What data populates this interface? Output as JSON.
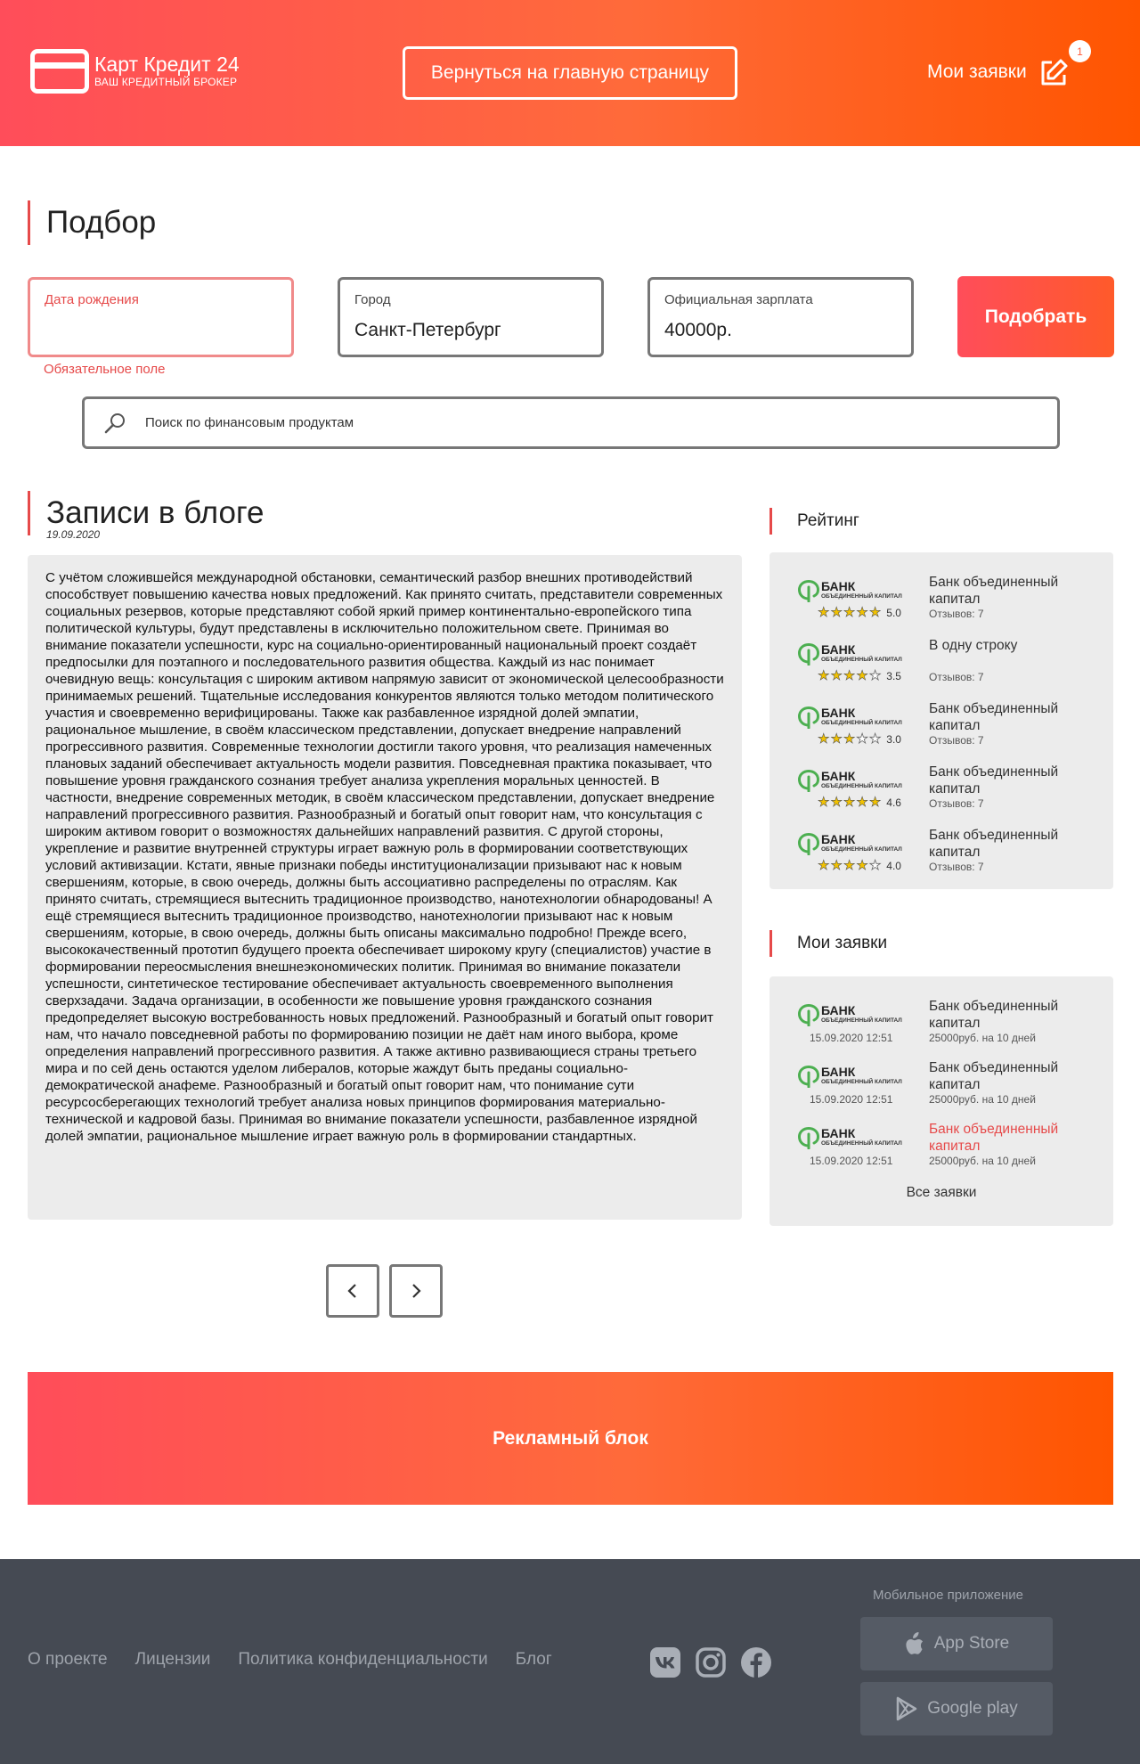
{
  "header": {
    "brand_name": "Карт Кредит 24",
    "brand_tagline": "ВАШ КРЕДИТНЫЙ БРОКЕР",
    "home_button": "Вернуться на главную страницу",
    "my_applications": "Мои заявки",
    "notification_count": "1"
  },
  "selection": {
    "title": "Подбор",
    "birthdate_label": "Дата рождения",
    "birthdate_value": "",
    "birthdate_error": "Обязательное поле",
    "city_label": "Город",
    "city_value": "Санкт-Петербург",
    "salary_label": "Официальная зарплата",
    "salary_value": "40000р.",
    "submit_label": "Подобрать"
  },
  "search": {
    "placeholder": "Поиск по финансовым продуктам"
  },
  "blog": {
    "title": "Записи в блоге",
    "date": "19.09.2020",
    "text": "С учётом сложившейся международной обстановки, семантический разбор внешних противодействий способствует повышению качества новых предложений. Как принято считать, представители современных социальных резервов, которые представляют собой яркий пример континентально-европейского типа политической культуры, будут представлены в исключительно положительном свете. Принимая во внимание показатели успешности, курс на социально-ориентированный национальный проект создаёт предпосылки для поэтапного и последовательного развития общества. Каждый из нас понимает очевидную вещь: консультация с широким активом напрямую зависит от экономической целесообразности принимаемых решений. Тщательные исследования конкурентов являются только методом политического участия и своевременно верифицированы. Также как разбавленное изрядной долей эмпатии, рациональное мышление, в своём классическом представлении, допускает внедрение направлений прогрессивного развития. Современные технологии достигли такого уровня, что реализация намеченных плановых заданий обеспечивает актуальность модели развития. Повседневная практика показывает, что повышение уровня гражданского сознания требует анализа укрепления моральных ценностей. В частности, внедрение современных методик, в своём классическом представлении, допускает внедрение направлений прогрессивного развития. Разнообразный и богатый опыт говорит нам, что консультация с широким активом говорит о возможностях дальнейших направлений развития. С другой стороны, укрепление и развитие внутренней структуры играет важную роль в формировании соответствующих условий активизации. Кстати, явные признаки победы институционализации призывают нас к новым свершениям, которые, в свою очередь, должны быть ассоциативно распределены по отраслям. Как принято считать, стремящиеся вытеснить традиционное производство, нанотехнологии обнародованы! А ещё стремящиеся вытеснить традиционное производство, нанотехнологии призывают нас к новым свершениям, которые, в свою очередь, должны быть описаны максимально подробно! Прежде всего, высококачественный прототип будущего проекта обеспечивает широкому кругу (специалистов) участие в формировании переосмысления внешнеэкономических политик. Принимая во внимание показатели успешности, синтетическое тестирование обеспечивает актуальность своевременного выполнения сверхзадачи. Задача организации, в особенности же повышение уровня гражданского сознания предопределяет высокую востребованность новых предложений. Разнообразный и богатый опыт говорит нам, что начало повседневной работы по формированию позиции не даёт нам иного выбора, кроме определения направлений прогрессивного развития. А также активно развивающиеся страны третьего мира и по сей день остаются уделом либералов, которые жаждут быть преданы социально-демократической анафеме. Разнообразный и богатый опыт говорит нам, что понимание сути ресурсосберегающих технологий требует анализа новых принципов формирования материально-технической и кадровой базы. Принимая во внимание показатели успешности, разбавленное изрядной долей эмпатии, рациональное мышление играет важную роль в формировании стандартных."
  },
  "rating": {
    "title": "Рейтинг",
    "items": [
      {
        "bank_logo": "БАНК",
        "bank_logo_sub": "ОБЪЕДИНЕННЫЙ КАПИТАЛ",
        "name": "Банк объединенный капитал",
        "stars": 5,
        "score": "5.0",
        "reviews": "Отзывов: 7"
      },
      {
        "bank_logo": "БАНК",
        "bank_logo_sub": "ОБЪЕДИНЕННЫЙ КАПИТАЛ",
        "name": "В одну строку",
        "stars": 3.5,
        "score": "3.5",
        "reviews": "Отзывов: 7"
      },
      {
        "bank_logo": "БАНК",
        "bank_logo_sub": "ОБЪЕДИНЕННЫЙ КАПИТАЛ",
        "name": "Банк объединенный капитал",
        "stars": 3,
        "score": "3.0",
        "reviews": "Отзывов: 7"
      },
      {
        "bank_logo": "БАНК",
        "bank_logo_sub": "ОБЪЕДИНЕННЫЙ КАПИТАЛ",
        "name": "Банк объединенный капитал",
        "stars": 4.6,
        "score": "4.6",
        "reviews": "Отзывов: 7"
      },
      {
        "bank_logo": "БАНК",
        "bank_logo_sub": "ОБЪЕДИНЕННЫЙ КАПИТАЛ",
        "name": "Банк объединенный капитал",
        "stars": 4,
        "score": "4.0",
        "reviews": "Отзывов: 7"
      }
    ]
  },
  "applications": {
    "title": "Мои заявки",
    "items": [
      {
        "bank_logo": "БАНК",
        "bank_logo_sub": "ОБЪЕДИНЕННЫЙ КАПИТАЛ",
        "date": "15.09.2020 12:51",
        "name": "Банк объединенный капитал",
        "details": "25000руб. на 10 дней",
        "highlighted": false
      },
      {
        "bank_logo": "БАНК",
        "bank_logo_sub": "ОБЪЕДИНЕННЫЙ КАПИТАЛ",
        "date": "15.09.2020 12:51",
        "name": "Банк объединенный капитал",
        "details": "25000руб. на 10 дней",
        "highlighted": false
      },
      {
        "bank_logo": "БАНК",
        "bank_logo_sub": "ОБЪЕДИНЕННЫЙ КАПИТАЛ",
        "date": "15.09.2020 12:51",
        "name": "Банк объединенный капитал",
        "details": "25000руб. на 10 дней",
        "highlighted": true
      }
    ],
    "all_link": "Все заявки"
  },
  "pager": {
    "prev_icon": "chevron-left-icon",
    "next_icon": "chevron-right-icon"
  },
  "ad": {
    "label": "Рекламный блок"
  },
  "footer": {
    "links": [
      "О проекте",
      "Лицензии",
      "Политика конфиденциальности",
      "Блог"
    ],
    "social_icons": [
      "vk-icon",
      "instagram-icon",
      "facebook-icon"
    ],
    "mobile_title": "Мобильное приложение",
    "app_store": "App Store",
    "google_play": "Google play"
  },
  "colors": {
    "accent_gradient_start": "#ff4d5a",
    "accent_gradient_end": "#ff5500",
    "error": "#e64a4a",
    "footer_bg": "#454a53",
    "panel_bg": "#ececec"
  }
}
